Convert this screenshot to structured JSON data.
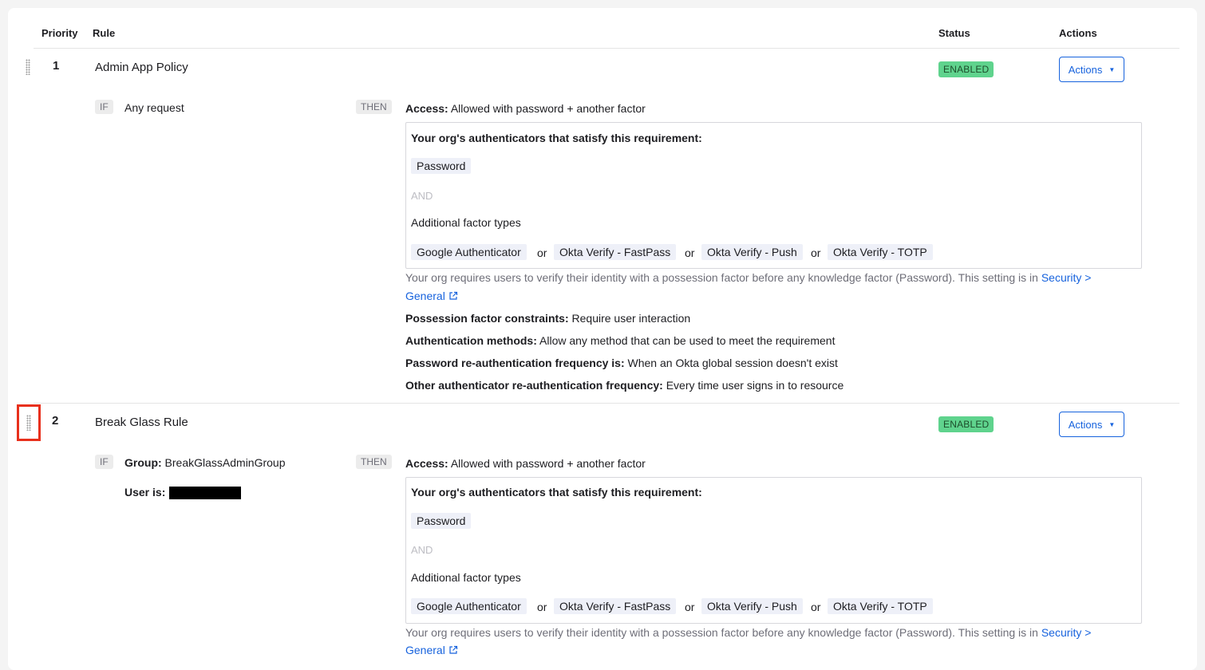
{
  "header": {
    "priority": "Priority",
    "rule": "Rule",
    "status": "Status",
    "actions": "Actions"
  },
  "rules": [
    {
      "priority": "1",
      "name": "Admin App Policy",
      "status": "ENABLED",
      "actions_label": "Actions",
      "if_label": "IF",
      "then_label": "THEN",
      "condition": "Any request",
      "access_label": "Access:",
      "access_value": "Allowed with password + another factor",
      "box_title": "Your org's authenticators that satisfy this requirement:",
      "primary_factor": "Password",
      "and_label": "AND",
      "additional_label": "Additional factor types",
      "factors": [
        "Google Authenticator",
        "Okta Verify - FastPass",
        "Okta Verify - Push",
        "Okta Verify - TOTP"
      ],
      "or_label": "or",
      "note_text": "Your org requires users to verify their identity with a possession factor before any knowledge factor (Password). This setting is in",
      "note_link_1": "Security >",
      "note_link_2": "General",
      "details": [
        {
          "label": "Possession factor constraints:",
          "value": "Require user interaction"
        },
        {
          "label": "Authentication methods:",
          "value": "Allow any method that can be used to meet the requirement"
        },
        {
          "label": "Password re-authentication frequency is:",
          "value": "When an Okta global session doesn't exist"
        },
        {
          "label": "Other authenticator re-authentication frequency:",
          "value": "Every time user signs in to resource"
        }
      ]
    },
    {
      "priority": "2",
      "name": "Break Glass Rule",
      "status": "ENABLED",
      "actions_label": "Actions",
      "if_label": "IF",
      "then_label": "THEN",
      "group_label": "Group:",
      "group_value": "BreakGlassAdminGroup",
      "user_label": "User is:",
      "access_label": "Access:",
      "access_value": "Allowed with password + another factor",
      "box_title": "Your org's authenticators that satisfy this requirement:",
      "primary_factor": "Password",
      "and_label": "AND",
      "additional_label": "Additional factor types",
      "factors": [
        "Google Authenticator",
        "Okta Verify - FastPass",
        "Okta Verify - Push",
        "Okta Verify - TOTP"
      ],
      "or_label": "or",
      "note_text": "Your org requires users to verify their identity with a possession factor before any knowledge factor (Password). This setting is in",
      "note_link_1": "Security >",
      "note_link_2": "General"
    }
  ],
  "colors": {
    "accent": "#1662dd",
    "enabled_badge": "#5fd38d",
    "highlight": "#e8301c"
  }
}
